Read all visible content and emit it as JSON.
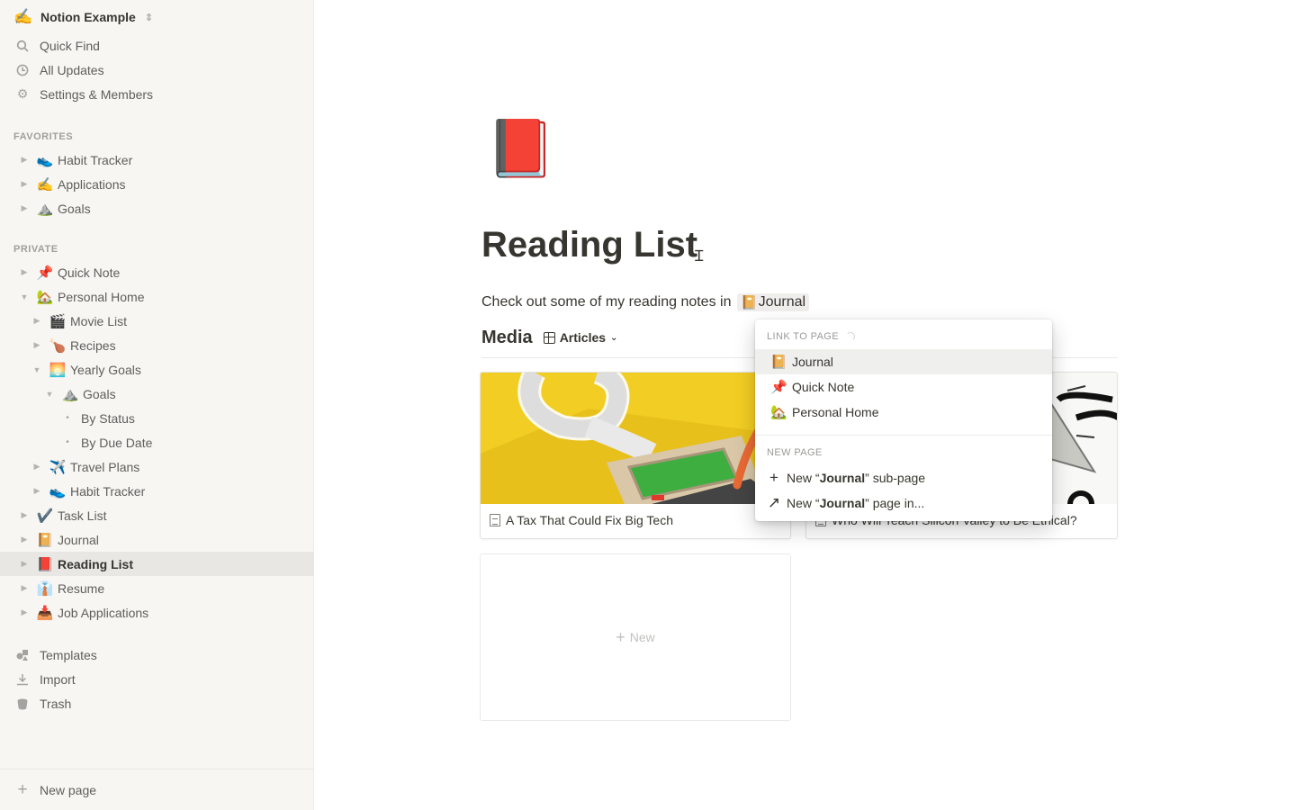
{
  "workspace": {
    "name": "Notion Example",
    "emoji": "✍️"
  },
  "sidebar_nav": [
    {
      "label": "Quick Find",
      "icon": "search-icon"
    },
    {
      "label": "All Updates",
      "icon": "clock-icon"
    },
    {
      "label": "Settings & Members",
      "icon": "gear-icon"
    }
  ],
  "favorites": {
    "label": "FAVORITES",
    "items": [
      {
        "label": "Habit Tracker",
        "emoji": "👟"
      },
      {
        "label": "Applications",
        "emoji": "✍️"
      },
      {
        "label": "Goals",
        "emoji": "⛰️"
      }
    ]
  },
  "private": {
    "label": "PRIVATE",
    "items": [
      {
        "label": "Quick Note",
        "emoji": "📌",
        "level": 0,
        "toggle": "collapsed"
      },
      {
        "label": "Personal Home",
        "emoji": "🏡",
        "level": 0,
        "toggle": "expanded"
      },
      {
        "label": "Movie List",
        "emoji": "🎬",
        "level": 1,
        "toggle": "collapsed"
      },
      {
        "label": "Recipes",
        "emoji": "🍗",
        "level": 1,
        "toggle": "collapsed"
      },
      {
        "label": "Yearly Goals",
        "emoji": "🌅",
        "level": 1,
        "toggle": "expanded"
      },
      {
        "label": "Goals",
        "emoji": "⛰️",
        "level": 2,
        "toggle": "expanded"
      },
      {
        "label": "By Status",
        "emoji": "",
        "level": 3,
        "toggle": "bullet"
      },
      {
        "label": "By Due Date",
        "emoji": "",
        "level": 3,
        "toggle": "bullet"
      },
      {
        "label": "Travel Plans",
        "emoji": "✈️",
        "level": 1,
        "toggle": "collapsed"
      },
      {
        "label": "Habit Tracker",
        "emoji": "👟",
        "level": 1,
        "toggle": "collapsed"
      },
      {
        "label": "Task List",
        "emoji": "✔️",
        "level": 0,
        "toggle": "collapsed"
      },
      {
        "label": "Journal",
        "emoji": "📔",
        "level": 0,
        "toggle": "collapsed"
      },
      {
        "label": "Reading List",
        "emoji": "📕",
        "level": 0,
        "toggle": "collapsed",
        "active": true
      },
      {
        "label": "Resume",
        "emoji": "👔",
        "level": 0,
        "toggle": "collapsed"
      },
      {
        "label": "Job Applications",
        "emoji": "📥",
        "level": 0,
        "toggle": "collapsed"
      }
    ]
  },
  "sidebar_tools": [
    {
      "label": "Templates",
      "icon": "templates-icon"
    },
    {
      "label": "Import",
      "icon": "import-icon"
    },
    {
      "label": "Trash",
      "icon": "trash-icon"
    }
  ],
  "new_page": {
    "label": "New page"
  },
  "page": {
    "icon": "📕",
    "title": "Reading List",
    "intro_text": "Check out some of my reading notes in",
    "mention": {
      "emoji": "📔",
      "label": "Journal"
    }
  },
  "database": {
    "title": "Media",
    "view": "Articles",
    "cards": [
      {
        "title": "A Tax That Could Fix Big Tech"
      },
      {
        "title": "Who Will Teach Silicon Valley to Be Ethical?"
      }
    ],
    "new_label": "New"
  },
  "menu": {
    "link_label": "LINK TO PAGE",
    "links": [
      {
        "label": "Journal",
        "emoji": "📔",
        "highlighted": true
      },
      {
        "label": "Quick Note",
        "emoji": "📌"
      },
      {
        "label": "Personal Home",
        "emoji": "🏡"
      }
    ],
    "new_label": "NEW PAGE",
    "new_items": [
      {
        "prefix": "New “",
        "name": "Journal",
        "suffix": "” sub-page",
        "icon": "plus-icon"
      },
      {
        "prefix": "New “",
        "name": "Journal",
        "suffix": "” page in...",
        "icon": "arrow-up-right-icon"
      }
    ]
  },
  "colors": {
    "sidebar_bg": "#f7f6f3",
    "active_row": "#e8e7e4",
    "text": "#37352f",
    "muted": "#9b9a97"
  }
}
